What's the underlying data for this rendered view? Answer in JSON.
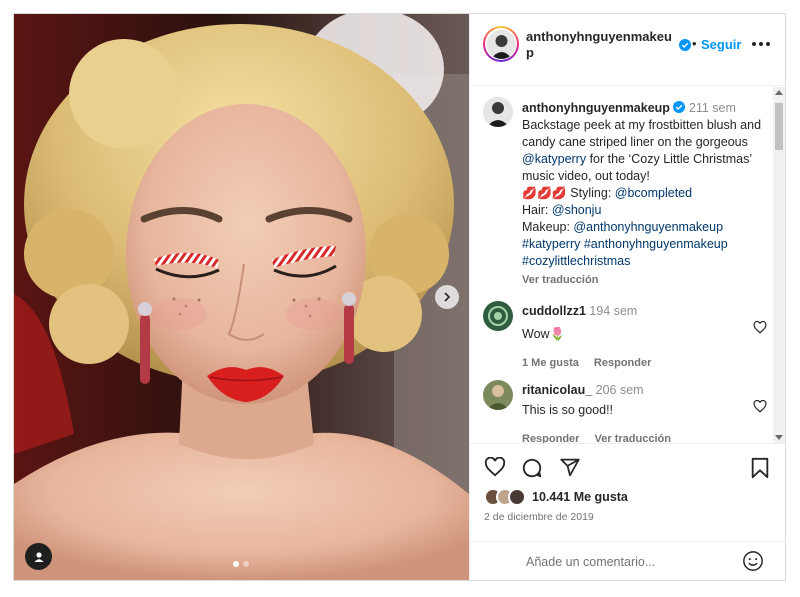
{
  "header": {
    "username": "anthonyhnguyenmakeup",
    "follow_label": "Seguir",
    "follow_sep": "•"
  },
  "caption": {
    "username": "anthonyhnguyenmakeup",
    "time": "211 sem",
    "text_1": "Backstage peek at my frostbitten blush and candy cane striped liner on the gorgeous ",
    "mention_katy": "@katyperry",
    "text_2": " for the ‘Cozy Little Christmas’ music video, out today!",
    "lips": "💋💋💋",
    "styling_label": " Styling: ",
    "mention_styling": "@bcompleted",
    "hair_label": "Hair: ",
    "mention_hair": "@shonju",
    "makeup_label": "Makeup: ",
    "mention_makeup": "@anthonyhnguyenmakeup",
    "tag_1": "#katyperry",
    "tag_2": "#anthonyhnguyenmakeup",
    "tag_3": "#cozylittlechristmas",
    "translate": "Ver traducción"
  },
  "comments": [
    {
      "username": "cuddollzz1",
      "time": "194 sem",
      "text": "Wow🌷",
      "likes": "1 Me gusta",
      "reply": "Responder"
    },
    {
      "username": "ritanicolau_",
      "time": "206 sem",
      "text": "This is so good!!",
      "reply": "Responder",
      "translate": "Ver traducción"
    }
  ],
  "likes": {
    "count_text": "10.441 Me gusta",
    "date": "2 de diciembre de 2019"
  },
  "add_comment": {
    "placeholder": "Añade un comentario..."
  },
  "icons": {
    "verified": "verified-badge-icon",
    "heart": "heart-icon",
    "comment": "comment-icon",
    "share": "share-icon",
    "save": "bookmark-icon",
    "emoji": "emoji-icon",
    "next": "chevron-right-icon",
    "user_tag": "user-tag-icon"
  },
  "colors": {
    "accent": "#0095f6",
    "link": "#00376b",
    "muted": "#737373"
  },
  "carousel": {
    "current": 1,
    "total": 2
  }
}
